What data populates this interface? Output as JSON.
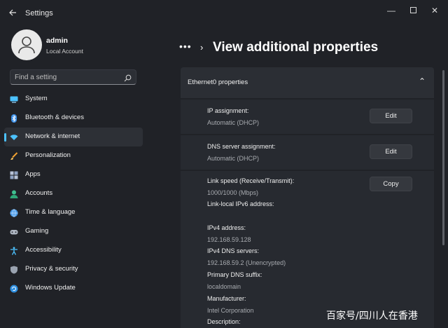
{
  "window": {
    "title": "Settings",
    "back_icon": "back-arrow-icon",
    "minimize_glyph": "—",
    "close_glyph": "✕"
  },
  "profile": {
    "name": "admin",
    "account_type": "Local Account"
  },
  "search": {
    "placeholder": "Find a setting",
    "icon": "search-icon"
  },
  "sidebar": {
    "items": [
      {
        "label": "System",
        "icon": "system-icon"
      },
      {
        "label": "Bluetooth & devices",
        "icon": "bluetooth-icon"
      },
      {
        "label": "Network & internet",
        "icon": "network-icon",
        "selected": true
      },
      {
        "label": "Personalization",
        "icon": "brush-icon"
      },
      {
        "label": "Apps",
        "icon": "apps-icon"
      },
      {
        "label": "Accounts",
        "icon": "accounts-icon"
      },
      {
        "label": "Time & language",
        "icon": "globe-icon"
      },
      {
        "label": "Gaming",
        "icon": "gaming-icon"
      },
      {
        "label": "Accessibility",
        "icon": "accessibility-icon"
      },
      {
        "label": "Privacy & security",
        "icon": "shield-icon"
      },
      {
        "label": "Windows Update",
        "icon": "update-icon"
      }
    ]
  },
  "header": {
    "breadcrumb_more": "•••",
    "chevron": "›",
    "title": "View additional properties"
  },
  "panel": {
    "title": "Ethernet0 properties",
    "collapse_glyph": "⌃",
    "ip_assignment": {
      "label": "IP assignment:",
      "value": "Automatic (DHCP)",
      "button": "Edit"
    },
    "dns_assignment": {
      "label": "DNS server assignment:",
      "value": "Automatic (DHCP)",
      "button": "Edit"
    },
    "details": {
      "copy_button": "Copy",
      "link_speed_label": "Link speed (Receive/Transmit):",
      "link_speed_value": "1000/1000 (Mbps)",
      "ipv6_label": "Link-local IPv6 address:",
      "ipv4_label": "IPv4 address:",
      "ipv4_value": "192.168.59.128",
      "ipv4_dns_label": "IPv4 DNS servers:",
      "ipv4_dns_value": "192.168.59.2 (Unencrypted)",
      "dns_suffix_label": "Primary DNS suffix:",
      "dns_suffix_value": "localdomain",
      "manufacturer_label": "Manufacturer:",
      "manufacturer_value": "Intel Corporation",
      "description_label": "Description:"
    }
  },
  "watermark": "百家号/四川人在香港",
  "colors": {
    "background": "#202227",
    "accent": "#4cc2ff",
    "card": "#272a30",
    "button": "#35383e"
  }
}
